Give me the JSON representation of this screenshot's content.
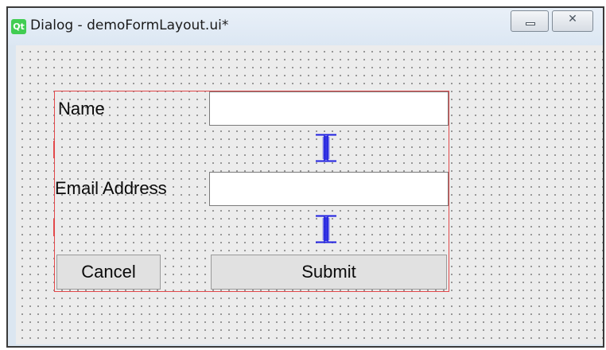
{
  "window": {
    "title": "Dialog - demoFormLayout.ui*",
    "app_icon_text": "Qt",
    "minimize_glyph": "",
    "close_glyph": "✕"
  },
  "form": {
    "name_label": "Name",
    "name_value": "",
    "email_label": "Email Address",
    "email_value": "",
    "cancel_label": "Cancel",
    "submit_label": "Submit"
  },
  "colors": {
    "layout_border": "#e2494b",
    "spacer_blue": "#1f1fe0",
    "canvas_bg": "#ececec"
  }
}
